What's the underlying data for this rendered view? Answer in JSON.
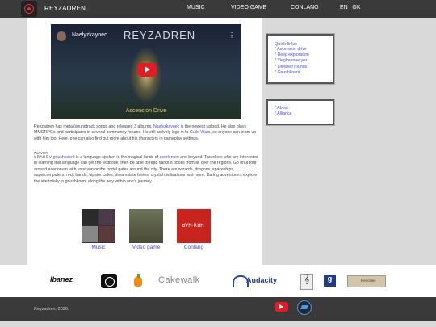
{
  "header": {
    "brand": "REYZADREN",
    "nav": [
      "MUSIC",
      "VIDEO GAME",
      "CONLANG",
      "EN | GK"
    ]
  },
  "video": {
    "channel": "Naelyzkayoec",
    "title": "REYZADREN",
    "caption": "Ascension Drive",
    "menu": "⋮"
  },
  "intro": {
    "part1": "Reyzadren has metal/soundtrack songs and released 3 albums. ",
    "link1": "Naelyzkayoec",
    "part2": " is the newest upload. He also plays MMORPGs and participates in several community forums. He still actively logs in to ",
    "link2": "Guild Wars",
    "part3": ", so anyone can team up with him too. Here, one can also find out more about his characters in gameplay settings."
  },
  "gnushkoent": {
    "glyph_small": "ꓣꓤꓥꓦꓧꓨ",
    "glyph_main": "ꓤꓣꓥꓧꓨꓦ",
    "link1": "gnushkoent",
    "part1": " is a language spoken in the magical lands of ",
    "link2": "aserlonum",
    "part2": " and beyond. Travellers who are interested in learning this language can get the textbook, then be able to read various books from all over the regions. Go on a tour around aserlonum with your van or the portal gates around the city. There are wizards, dragons, spaceships, supercomputers, rock bands, hipster cafes, dreamstate fairies, crystal civilisations and more. Daring adventurers explore the site totally in gnushkoent along the way within one's journey."
  },
  "tiles": {
    "music": "Music",
    "game": "Video game",
    "conlang": "Conlang",
    "conlang_thumb": "ꓤꓦꓧ·ꓣꓤꓧ"
  },
  "quicklinks": {
    "title": "Quick links:",
    "items": [
      "* Ascension drive",
      "* Deep exploration",
      "* Yleglorenae yoz",
      "* Lifeshelf rounds",
      "* Gnushkoent"
    ]
  },
  "aboutlinks": {
    "items": [
      "* About",
      "* Alliance"
    ]
  },
  "brands": [
    "Ibanez",
    "Shure",
    "FL Studio",
    "Cakewalk",
    "Audacity",
    "MuseScore",
    "Goodreads",
    "Neocities"
  ],
  "footer": {
    "copyright": "Reyzadren, 2026."
  },
  "colors": {
    "topbar": "#3a3a3a",
    "link": "#4a4ad0",
    "youtube": "#e51b23"
  }
}
